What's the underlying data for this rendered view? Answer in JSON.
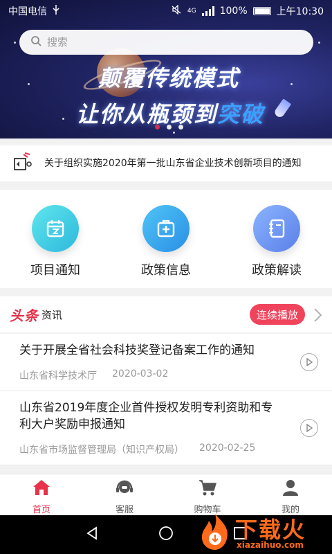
{
  "status_bar": {
    "carrier": "中国电信",
    "network": "4G",
    "battery": "100%",
    "time": "上午10:30"
  },
  "search": {
    "placeholder": "搜索"
  },
  "banner": {
    "line1": "颠覆传统模式",
    "line2_part1": "让你从瓶颈到",
    "line2_part2": "突破",
    "page_count": 3,
    "active_page": 1
  },
  "notice": {
    "icon": "megaphone-icon",
    "text": "关于组织实施2020年第一批山东省企业技术创新项目的通知"
  },
  "quick_menu": [
    {
      "label": "项目通知",
      "icon": "calendar-icon"
    },
    {
      "label": "政策信息",
      "icon": "medical-kit-icon"
    },
    {
      "label": "政策解读",
      "icon": "notebook-icon"
    }
  ],
  "news": {
    "logo": "头条",
    "subtitle": "资讯",
    "play_all_label": "连续播放",
    "items": [
      {
        "title": "关于开展全省社会科技奖登记备案工作的通知",
        "source": "山东省科学技术厅",
        "date": "2020-03-02"
      },
      {
        "title": "山东省2019年度企业首件授权发明专利资助和专利大户奖励申报通知",
        "source": "山东省市场监督管理局（知识产权局）",
        "date": "2020-02-25"
      }
    ]
  },
  "tabbar": {
    "items": [
      {
        "label": "首页",
        "icon": "home-icon",
        "active": true
      },
      {
        "label": "客服",
        "icon": "headset-icon",
        "active": false
      },
      {
        "label": "购物车",
        "icon": "cart-icon",
        "active": false
      },
      {
        "label": "我的",
        "icon": "user-icon",
        "active": false
      }
    ]
  },
  "watermark": {
    "text": "下载火",
    "url": "xiazaihuo.com"
  },
  "colors": {
    "accent": "#e8314a",
    "banner_bg": "#1b1f5a"
  }
}
